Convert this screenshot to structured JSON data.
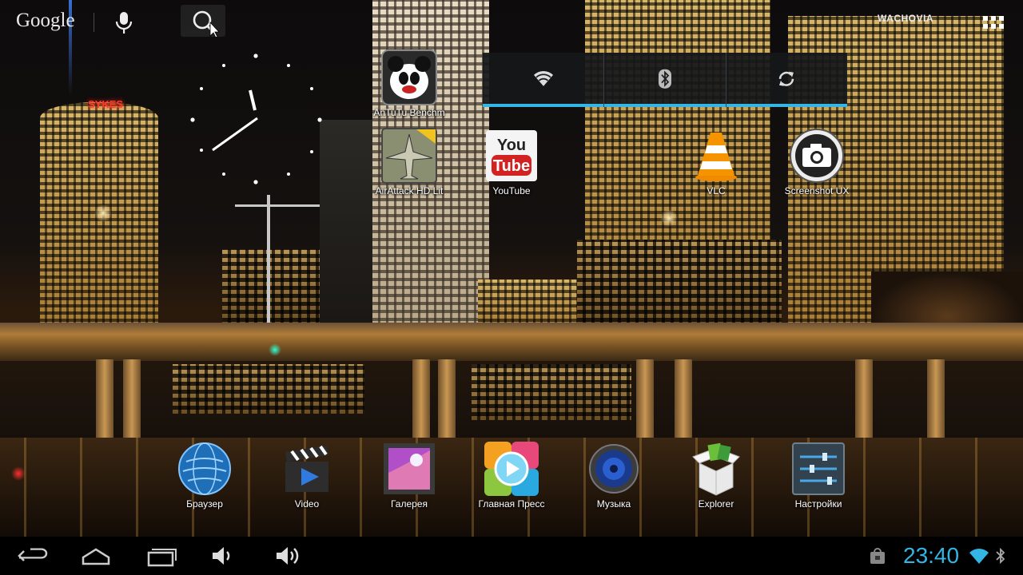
{
  "search_bar": {
    "logo": "Google"
  },
  "quick_settings": {
    "toggles": [
      "wifi-icon",
      "bluetooth-icon",
      "sync-icon"
    ],
    "accent_color": "#33b5e5"
  },
  "workspace_apps": [
    {
      "label": "AnTuTu Benchm",
      "icon": "antutu-icon"
    },
    {
      "label": "AirAttack HD Lit",
      "icon": "airattack-icon"
    },
    {
      "label": "YouTube",
      "icon": "youtube-icon"
    },
    {
      "label": "VLC",
      "icon": "vlc-icon"
    },
    {
      "label": "Screenshot UX",
      "icon": "camera-icon"
    }
  ],
  "dock_apps": [
    {
      "label": "Браузер",
      "icon": "globe-icon"
    },
    {
      "label": "Video",
      "icon": "clapperboard-icon"
    },
    {
      "label": "Галерея",
      "icon": "gallery-icon"
    },
    {
      "label": "Главная Пресс",
      "icon": "play-icon"
    },
    {
      "label": "Музыка",
      "icon": "speaker-icon"
    },
    {
      "label": "Explorer",
      "icon": "box-icon"
    },
    {
      "label": "Настройки",
      "icon": "sliders-icon"
    }
  ],
  "wallpaper_signs": {
    "sykes": "SYKES",
    "wachovia": "WACHOVIA"
  },
  "system_bar": {
    "time": "23:40",
    "time_color": "#33b5e5"
  }
}
